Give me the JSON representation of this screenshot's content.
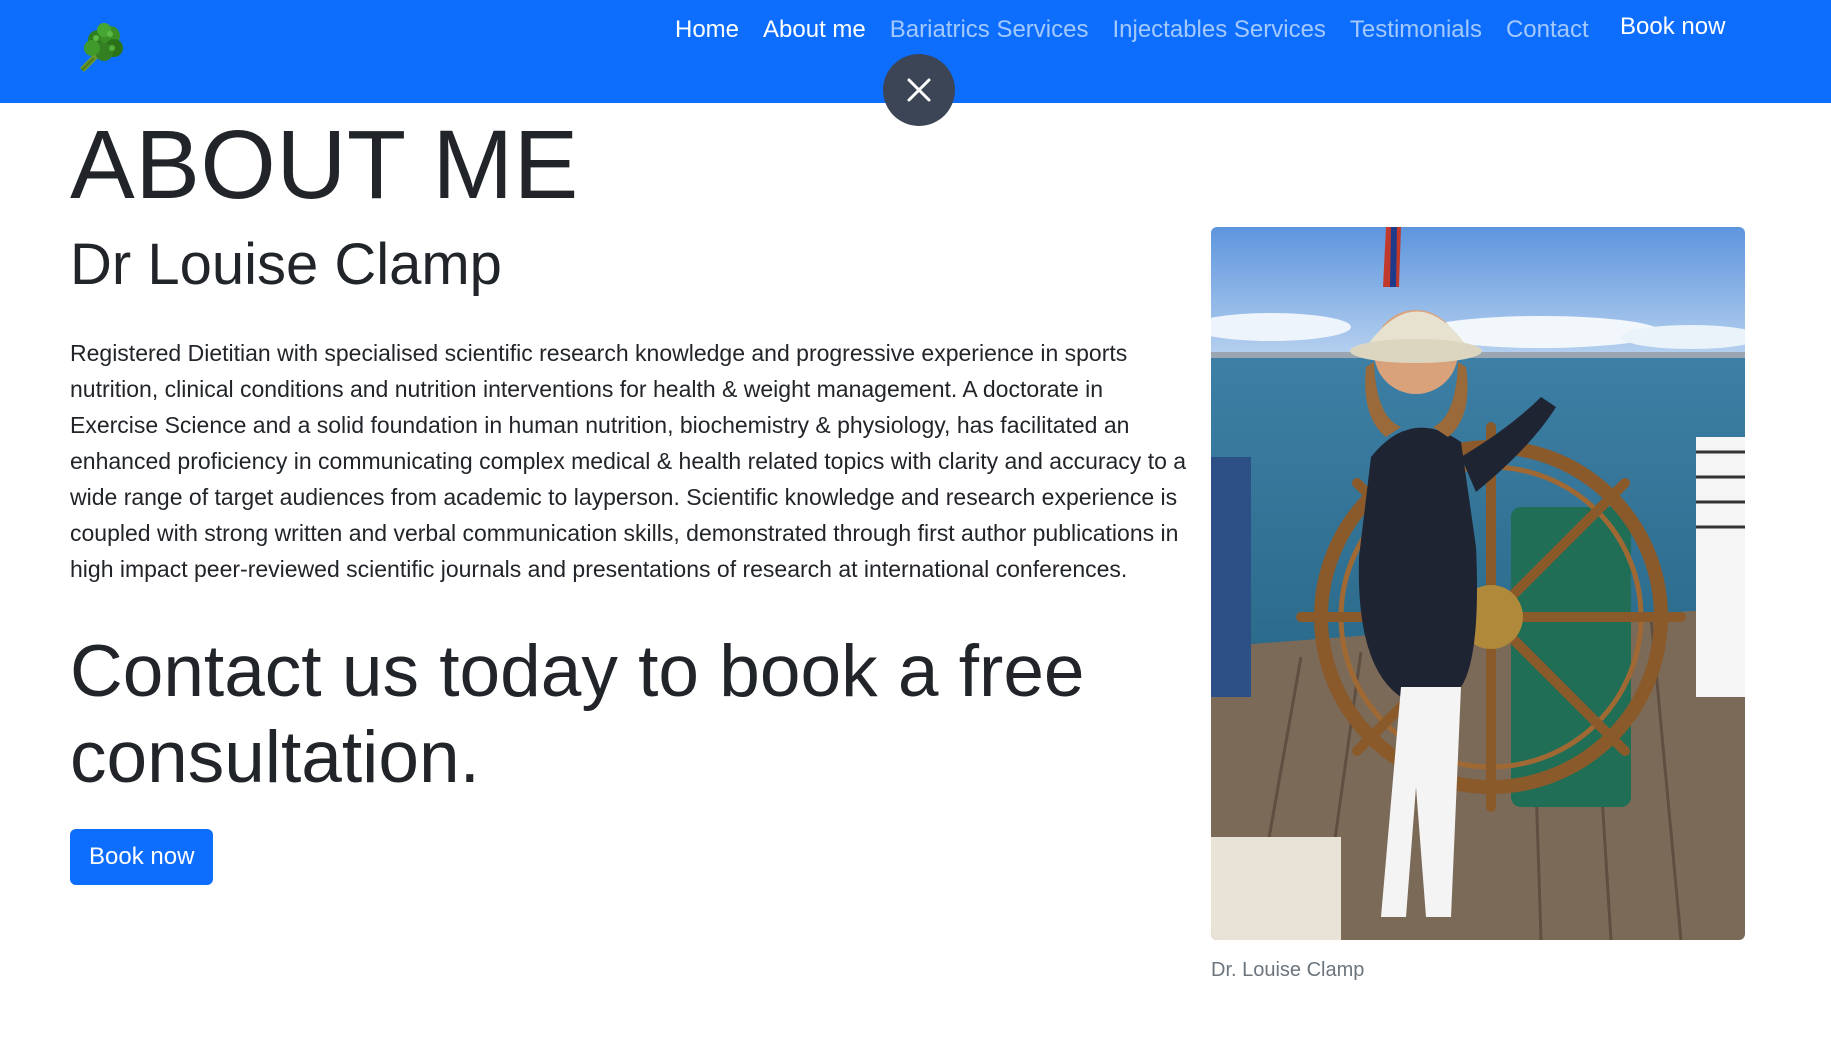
{
  "nav": {
    "links": [
      {
        "label": "Home",
        "active": true
      },
      {
        "label": "About me",
        "active": true
      },
      {
        "label": "Bariatrics Services",
        "active": false
      },
      {
        "label": "Injectables Services",
        "active": false
      },
      {
        "label": "Testimonials",
        "active": false
      },
      {
        "label": "Contact",
        "active": false
      }
    ],
    "book_label": "Book now",
    "brand_icon": "broccoli-icon",
    "close_icon": "close-icon"
  },
  "about": {
    "title": "ABOUT ME",
    "name": "Dr Louise Clamp",
    "bio": "Registered Dietitian with specialised scientific research knowledge and progressive experience in sports nutrition, clinical conditions and nutrition interventions for health & weight management. A doctorate in Exercise Science and a solid foundation in human nutrition, biochemistry & physiology, has facilitated an enhanced proficiency in communicating complex medical & health related topics with clarity and accuracy to a wide range of target audiences from academic to layperson. Scientific knowledge and research experience is coupled with strong written and verbal communication skills, demonstrated through first author publications in high impact peer-reviewed scientific journals and presentations of research at international conferences.",
    "cta": "Contact us today to book a free consultation.",
    "book_label": "Book now"
  },
  "figure": {
    "caption": "Dr. Louise Clamp"
  },
  "colors": {
    "primary": "#0d6efd",
    "close_bg": "#3c4555",
    "text": "#212529",
    "caption": "#6c757d"
  }
}
